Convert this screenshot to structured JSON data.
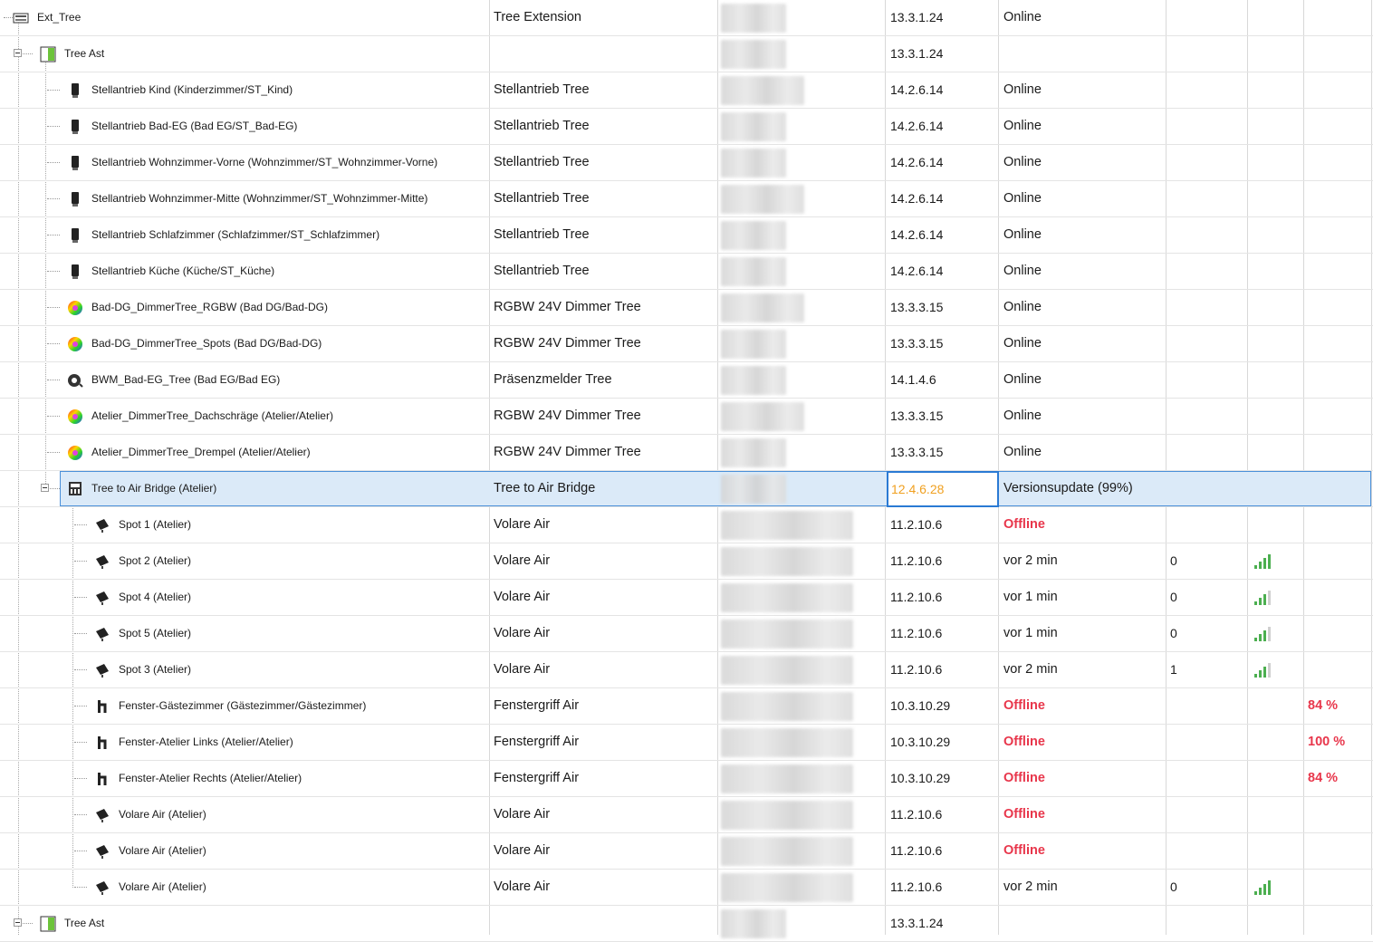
{
  "colors": {
    "offline": "#e8364b",
    "update_version": "#f0a020",
    "selection": "#dbeaf8",
    "signal": "#4caf50"
  },
  "rows": [
    {
      "indent": 0,
      "expander": false,
      "icon": "extension-module-icon",
      "name": "Ext_Tree",
      "type": "Tree Extension",
      "version": "13.3.1.24",
      "status": "Online",
      "quality": "",
      "battery": "",
      "signal": 0,
      "offline": false
    },
    {
      "indent": 1,
      "expander": true,
      "icon": "tree-branch-icon",
      "name": "Tree Ast",
      "type": "",
      "version": "13.3.1.24",
      "status": "",
      "quality": "",
      "battery": "",
      "signal": 0,
      "offline": false
    },
    {
      "indent": 2,
      "expander": false,
      "icon": "actuator-icon",
      "name": "Stellantrieb Kind (Kinderzimmer/ST_Kind)",
      "type": "Stellantrieb Tree",
      "version": "14.2.6.14",
      "status": "Online",
      "quality": "",
      "battery": "",
      "signal": 0,
      "offline": false
    },
    {
      "indent": 2,
      "expander": false,
      "icon": "actuator-icon",
      "name": "Stellantrieb Bad-EG (Bad EG/ST_Bad-EG)",
      "type": "Stellantrieb Tree",
      "version": "14.2.6.14",
      "status": "Online",
      "quality": "",
      "battery": "",
      "signal": 0,
      "offline": false
    },
    {
      "indent": 2,
      "expander": false,
      "icon": "actuator-icon",
      "name": "Stellantrieb Wohnzimmer-Vorne (Wohnzimmer/ST_Wohnzimmer-Vorne)",
      "type": "Stellantrieb Tree",
      "version": "14.2.6.14",
      "status": "Online",
      "quality": "",
      "battery": "",
      "signal": 0,
      "offline": false
    },
    {
      "indent": 2,
      "expander": false,
      "icon": "actuator-icon",
      "name": "Stellantrieb Wohnzimmer-Mitte (Wohnzimmer/ST_Wohnzimmer-Mitte)",
      "type": "Stellantrieb Tree",
      "version": "14.2.6.14",
      "status": "Online",
      "quality": "",
      "battery": "",
      "signal": 0,
      "offline": false
    },
    {
      "indent": 2,
      "expander": false,
      "icon": "actuator-icon",
      "name": "Stellantrieb Schlafzimmer (Schlafzimmer/ST_Schlafzimmer)",
      "type": "Stellantrieb Tree",
      "version": "14.2.6.14",
      "status": "Online",
      "quality": "",
      "battery": "",
      "signal": 0,
      "offline": false
    },
    {
      "indent": 2,
      "expander": false,
      "icon": "actuator-icon",
      "name": "Stellantrieb Küche (Küche/ST_Küche)",
      "type": "Stellantrieb Tree",
      "version": "14.2.6.14",
      "status": "Online",
      "quality": "",
      "battery": "",
      "signal": 0,
      "offline": false
    },
    {
      "indent": 2,
      "expander": false,
      "icon": "rgbw-dimmer-icon",
      "name": "Bad-DG_DimmerTree_RGBW (Bad DG/Bad-DG)",
      "type": "RGBW 24V Dimmer Tree",
      "version": "13.3.3.15",
      "status": "Online",
      "quality": "",
      "battery": "",
      "signal": 0,
      "offline": false
    },
    {
      "indent": 2,
      "expander": false,
      "icon": "rgbw-dimmer-icon",
      "name": "Bad-DG_DimmerTree_Spots (Bad DG/Bad-DG)",
      "type": "RGBW 24V Dimmer Tree",
      "version": "13.3.3.15",
      "status": "Online",
      "quality": "",
      "battery": "",
      "signal": 0,
      "offline": false
    },
    {
      "indent": 2,
      "expander": false,
      "icon": "presence-sensor-icon",
      "name": "BWM_Bad-EG_Tree (Bad EG/Bad EG)",
      "type": "Präsenzmelder Tree",
      "version": "14.1.4.6",
      "status": "Online",
      "quality": "",
      "battery": "",
      "signal": 0,
      "offline": false
    },
    {
      "indent": 2,
      "expander": false,
      "icon": "rgbw-dimmer-icon",
      "name": "Atelier_DimmerTree_Dachschräge (Atelier/Atelier)",
      "type": "RGBW 24V Dimmer Tree",
      "version": "13.3.3.15",
      "status": "Online",
      "quality": "",
      "battery": "",
      "signal": 0,
      "offline": false
    },
    {
      "indent": 2,
      "expander": false,
      "icon": "rgbw-dimmer-icon",
      "name": "Atelier_DimmerTree_Drempel (Atelier/Atelier)",
      "type": "RGBW 24V Dimmer Tree",
      "version": "13.3.3.15",
      "status": "Online",
      "quality": "",
      "battery": "",
      "signal": 0,
      "offline": false
    },
    {
      "indent": 2,
      "expander": true,
      "icon": "air-bridge-icon",
      "name": "Tree to Air Bridge (Atelier)",
      "type": "Tree to Air Bridge",
      "version": "12.4.6.28",
      "status": "Versionsupdate (99%)",
      "quality": "",
      "battery": "",
      "signal": 0,
      "offline": false,
      "selected": true
    },
    {
      "indent": 3,
      "expander": false,
      "icon": "spotlight-icon",
      "name": "Spot 1 (Atelier)",
      "type": "Volare Air",
      "version": "11.2.10.6",
      "status": "Offline",
      "quality": "",
      "battery": "",
      "signal": 0,
      "offline": true
    },
    {
      "indent": 3,
      "expander": false,
      "icon": "spotlight-icon",
      "name": "Spot 2 (Atelier)",
      "type": "Volare Air",
      "version": "11.2.10.6",
      "status": "vor 2 min",
      "quality": "0",
      "battery": "",
      "signal": 4,
      "offline": false
    },
    {
      "indent": 3,
      "expander": false,
      "icon": "spotlight-icon",
      "name": "Spot 4 (Atelier)",
      "type": "Volare Air",
      "version": "11.2.10.6",
      "status": "vor 1 min",
      "quality": "0",
      "battery": "",
      "signal": 3,
      "offline": false
    },
    {
      "indent": 3,
      "expander": false,
      "icon": "spotlight-icon",
      "name": "Spot 5 (Atelier)",
      "type": "Volare Air",
      "version": "11.2.10.6",
      "status": "vor 1 min",
      "quality": "0",
      "battery": "",
      "signal": 3,
      "offline": false
    },
    {
      "indent": 3,
      "expander": false,
      "icon": "spotlight-icon",
      "name": "Spot 3 (Atelier)",
      "type": "Volare Air",
      "version": "11.2.10.6",
      "status": "vor 2 min",
      "quality": "1",
      "battery": "",
      "signal": 3,
      "offline": false
    },
    {
      "indent": 3,
      "expander": false,
      "icon": "window-handle-icon",
      "name": "Fenster-Gästezimmer (Gästezimmer/Gästezimmer)",
      "type": "Fenstergriff Air",
      "version": "10.3.10.29",
      "status": "Offline",
      "quality": "",
      "battery": "84 %",
      "signal": 0,
      "offline": true
    },
    {
      "indent": 3,
      "expander": false,
      "icon": "window-handle-icon",
      "name": "Fenster-Atelier Links (Atelier/Atelier)",
      "type": "Fenstergriff Air",
      "version": "10.3.10.29",
      "status": "Offline",
      "quality": "",
      "battery": "100 %",
      "signal": 0,
      "offline": true
    },
    {
      "indent": 3,
      "expander": false,
      "icon": "window-handle-icon",
      "name": "Fenster-Atelier Rechts (Atelier/Atelier)",
      "type": "Fenstergriff Air",
      "version": "10.3.10.29",
      "status": "Offline",
      "quality": "",
      "battery": "84 %",
      "signal": 0,
      "offline": true
    },
    {
      "indent": 3,
      "expander": false,
      "icon": "spotlight-icon",
      "name": "Volare Air (Atelier)",
      "type": "Volare Air",
      "version": "11.2.10.6",
      "status": "Offline",
      "quality": "",
      "battery": "",
      "signal": 0,
      "offline": true
    },
    {
      "indent": 3,
      "expander": false,
      "icon": "spotlight-icon",
      "name": "Volare Air (Atelier)",
      "type": "Volare Air",
      "version": "11.2.10.6",
      "status": "Offline",
      "quality": "",
      "battery": "",
      "signal": 0,
      "offline": true
    },
    {
      "indent": 3,
      "expander": false,
      "icon": "spotlight-icon",
      "name": "Volare Air (Atelier)",
      "type": "Volare Air",
      "version": "11.2.10.6",
      "status": "vor 2 min",
      "quality": "0",
      "battery": "",
      "signal": 4,
      "offline": false
    },
    {
      "indent": 1,
      "expander": true,
      "icon": "tree-branch-icon",
      "name": "Tree Ast",
      "type": "",
      "version": "13.3.1.24",
      "status": "",
      "quality": "",
      "battery": "",
      "signal": 0,
      "offline": false
    }
  ]
}
